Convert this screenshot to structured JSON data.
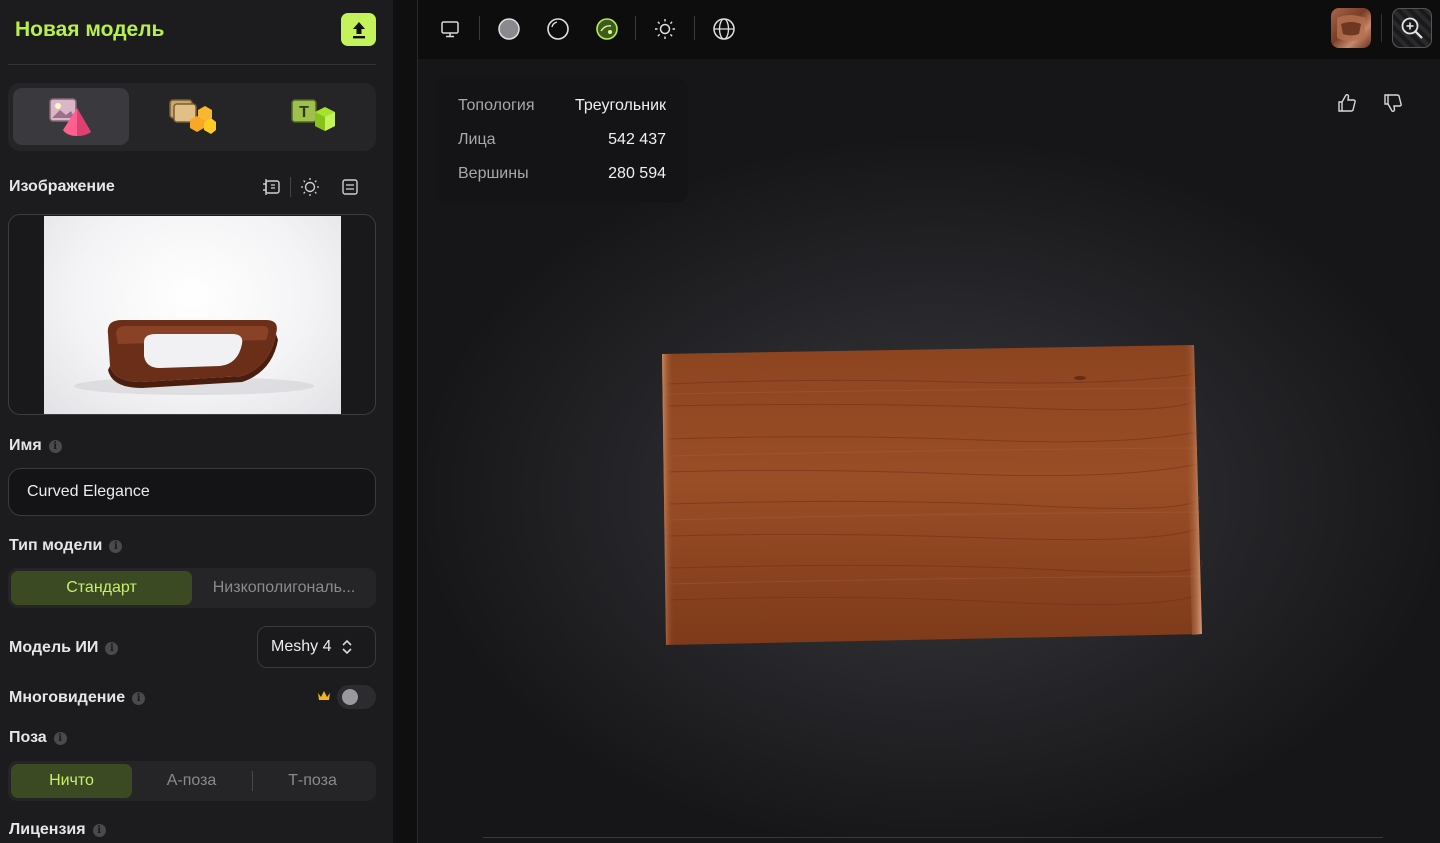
{
  "sidebar": {
    "title": "Новая модель",
    "upload_icon": "upload-icon",
    "mode_tabs": [
      {
        "name": "image-to-3d",
        "icon": "image-to-3d-icon",
        "active": true
      },
      {
        "name": "multi-image-to-3d",
        "icon": "multi-image-icon",
        "active": false
      },
      {
        "name": "text-to-3d",
        "icon": "text-to-3d-icon",
        "active": false
      }
    ],
    "image_section": {
      "label": "Изображение",
      "tools": [
        "compare-icon",
        "light-bulb-icon",
        "panel-icon"
      ]
    },
    "name_section": {
      "label": "Имя",
      "value": "Curved Elegance"
    },
    "model_type": {
      "label": "Тип модели",
      "options": [
        "Стандарт",
        "Низкополигональ..."
      ],
      "selected": "Стандарт"
    },
    "ai_model": {
      "label": "Модель ИИ",
      "value": "Meshy 4"
    },
    "multiview": {
      "label": "Многовидение",
      "enabled": false,
      "premium_icon": "crown-icon"
    },
    "pose": {
      "label": "Поза",
      "options": [
        "Ничто",
        "А-поза",
        "Т-поза"
      ],
      "selected": "Ничто"
    },
    "license": {
      "label": "Лицензия"
    }
  },
  "toolbar": {
    "icons": [
      "monitor-icon",
      "solid-sphere-icon",
      "outline-sphere-icon",
      "textured-sphere-icon",
      "sun-icon",
      "globe-icon"
    ],
    "right_icons": [
      "model-thumbnail",
      "zoom-icon"
    ]
  },
  "stats": {
    "rows": [
      {
        "key": "Топология",
        "value": "Треугольник"
      },
      {
        "key": "Лица",
        "value": "542 437"
      },
      {
        "key": "Вершины",
        "value": "280 594"
      }
    ]
  },
  "feedback": {
    "icons": [
      "thumbs-up-icon",
      "thumbs-down-icon"
    ]
  },
  "colors": {
    "accent": "#b8f04a",
    "accent_button": "#c4f25a",
    "active_segment_bg": "#3b4a22",
    "active_segment_text": "#c6f06a",
    "panel_bg": "#1c1c1e",
    "wood": "#8a3f1c"
  }
}
